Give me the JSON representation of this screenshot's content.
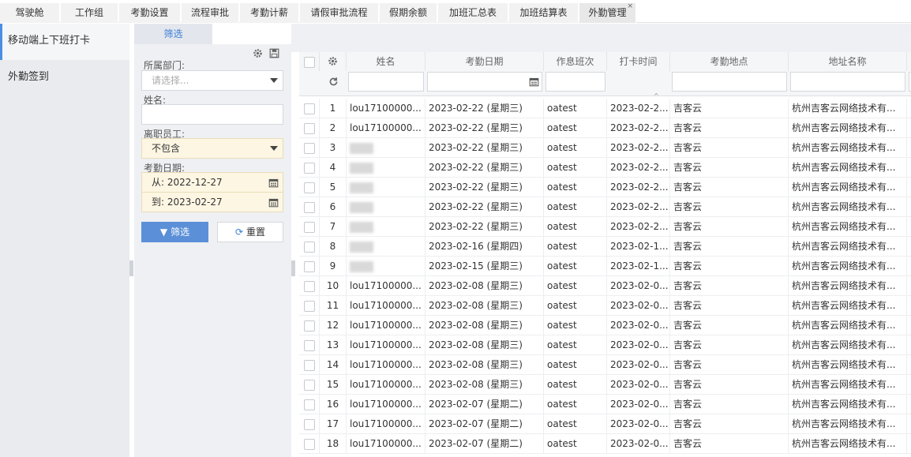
{
  "tabs": [
    {
      "label": "驾驶舱"
    },
    {
      "label": "工作组"
    },
    {
      "label": "考勤设置"
    },
    {
      "label": "流程审批"
    },
    {
      "label": "考勤计薪"
    },
    {
      "label": "请假审批流程"
    },
    {
      "label": "假期余额"
    },
    {
      "label": "加班汇总表"
    },
    {
      "label": "加班结算表"
    },
    {
      "label": "外勤管理",
      "close": "×"
    }
  ],
  "sidebar": {
    "items": [
      {
        "label": "移动端上下班打卡"
      },
      {
        "label": "外勤签到"
      }
    ]
  },
  "filter": {
    "tab_label": "筛选",
    "dept_label": "所属部门:",
    "dept_placeholder": "请选择...",
    "name_label": "姓名:",
    "name_value": "",
    "resigned_label": "离职员工:",
    "resigned_value": "不包含",
    "date_label": "考勤日期:",
    "date_from": "从:  2022-12-27",
    "date_to": "到:  2023-02-27",
    "filter_button": "筛选",
    "reset_button": "重置"
  },
  "grid": {
    "columns": [
      "姓名",
      "考勤日期",
      "作息班次",
      "打卡时间",
      "考勤地点",
      "地址名称"
    ],
    "rows": [
      {
        "num": "1",
        "name": "lou17100000...",
        "blurred": false,
        "date": "2023-02-22 (星期三)",
        "shift": "oatest",
        "time": "2023-02-2...",
        "location": "吉客云",
        "address": "杭州吉客云网络技术有..."
      },
      {
        "num": "2",
        "name": "lou17100000...",
        "blurred": false,
        "date": "2023-02-22 (星期三)",
        "shift": "oatest",
        "time": "2023-02-2...",
        "location": "吉客云",
        "address": "杭州吉客云网络技术有..."
      },
      {
        "num": "3",
        "name": "",
        "blurred": true,
        "date": "2023-02-22 (星期三)",
        "shift": "oatest",
        "time": "2023-02-2...",
        "location": "吉客云",
        "address": "杭州吉客云网络技术有..."
      },
      {
        "num": "4",
        "name": "",
        "blurred": true,
        "date": "2023-02-22 (星期三)",
        "shift": "oatest",
        "time": "2023-02-2...",
        "location": "吉客云",
        "address": "杭州吉客云网络技术有..."
      },
      {
        "num": "5",
        "name": "",
        "blurred": true,
        "date": "2023-02-22 (星期三)",
        "shift": "oatest",
        "time": "2023-02-2...",
        "location": "吉客云",
        "address": "杭州吉客云网络技术有..."
      },
      {
        "num": "6",
        "name": "",
        "blurred": true,
        "date": "2023-02-22 (星期三)",
        "shift": "oatest",
        "time": "2023-02-2...",
        "location": "吉客云",
        "address": "杭州吉客云网络技术有..."
      },
      {
        "num": "7",
        "name": "",
        "blurred": true,
        "date": "2023-02-22 (星期三)",
        "shift": "oatest",
        "time": "2023-02-2...",
        "location": "吉客云",
        "address": "杭州吉客云网络技术有..."
      },
      {
        "num": "8",
        "name": "",
        "blurred": true,
        "date": "2023-02-16 (星期四)",
        "shift": "oatest",
        "time": "2023-02-1...",
        "location": "吉客云",
        "address": "杭州吉客云网络技术有..."
      },
      {
        "num": "9",
        "name": "",
        "blurred": true,
        "date": "2023-02-15 (星期三)",
        "shift": "oatest",
        "time": "2023-02-1...",
        "location": "吉客云",
        "address": "杭州吉客云网络技术有..."
      },
      {
        "num": "10",
        "name": "lou17100000...",
        "blurred": false,
        "date": "2023-02-08 (星期三)",
        "shift": "oatest",
        "time": "2023-02-0...",
        "location": "吉客云",
        "address": "杭州吉客云网络技术有..."
      },
      {
        "num": "11",
        "name": "lou17100000...",
        "blurred": false,
        "date": "2023-02-08 (星期三)",
        "shift": "oatest",
        "time": "2023-02-0...",
        "location": "吉客云",
        "address": "杭州吉客云网络技术有..."
      },
      {
        "num": "12",
        "name": "lou17100000...",
        "blurred": false,
        "date": "2023-02-08 (星期三)",
        "shift": "oatest",
        "time": "2023-02-0...",
        "location": "吉客云",
        "address": "杭州吉客云网络技术有..."
      },
      {
        "num": "13",
        "name": "lou17100000...",
        "blurred": false,
        "date": "2023-02-08 (星期三)",
        "shift": "oatest",
        "time": "2023-02-0...",
        "location": "吉客云",
        "address": "杭州吉客云网络技术有..."
      },
      {
        "num": "14",
        "name": "lou17100000...",
        "blurred": false,
        "date": "2023-02-08 (星期三)",
        "shift": "oatest",
        "time": "2023-02-0...",
        "location": "吉客云",
        "address": "杭州吉客云网络技术有..."
      },
      {
        "num": "15",
        "name": "lou17100000...",
        "blurred": false,
        "date": "2023-02-08 (星期三)",
        "shift": "oatest",
        "time": "2023-02-0...",
        "location": "吉客云",
        "address": "杭州吉客云网络技术有..."
      },
      {
        "num": "16",
        "name": "lou17100000...",
        "blurred": false,
        "date": "2023-02-07 (星期二)",
        "shift": "oatest",
        "time": "2023-02-0...",
        "location": "吉客云",
        "address": "杭州吉客云网络技术有..."
      },
      {
        "num": "17",
        "name": "lou17100000...",
        "blurred": false,
        "date": "2023-02-07 (星期二)",
        "shift": "oatest",
        "time": "2023-02-0...",
        "location": "吉客云",
        "address": "杭州吉客云网络技术有..."
      },
      {
        "num": "18",
        "name": "lou17100000...",
        "blurred": false,
        "date": "2023-02-07 (星期二)",
        "shift": "oatest",
        "time": "2023-02-0...",
        "location": "吉客云",
        "address": "杭州吉客云网络技术有..."
      }
    ]
  },
  "colors": {
    "accent": "#3a7bd5",
    "primary_button": "#5b8fd8",
    "highlight_input": "#fdf6e3",
    "sidebar_bg": "#e9ebee"
  },
  "icons": {
    "gear": "gear-icon",
    "save": "save-icon",
    "calendar": "calendar-icon",
    "refresh": "refresh-icon",
    "filter": "filter-icon"
  }
}
